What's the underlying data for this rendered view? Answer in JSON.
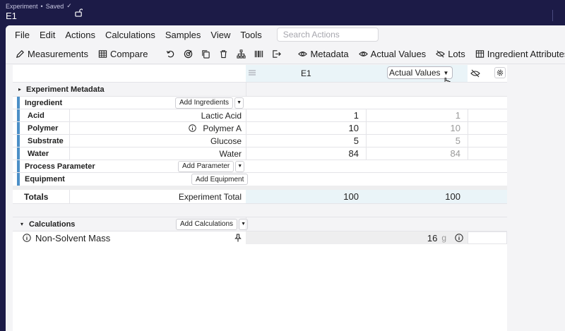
{
  "topbar": {
    "breadcrumb": "Experiment",
    "saved": "Saved",
    "check": "✓",
    "title": "E1"
  },
  "menu": {
    "items": [
      "File",
      "Edit",
      "Actions",
      "Calculations",
      "Samples",
      "View",
      "Tools"
    ],
    "search_placeholder": "Search Actions"
  },
  "toolbar": {
    "measurements": "Measurements",
    "compare": "Compare",
    "metadata": "Metadata",
    "actual_values": "Actual Values",
    "lots": "Lots",
    "ingredient_attributes": "Ingredient Attributes"
  },
  "header": {
    "column": "E1",
    "view_select": "Actual Values"
  },
  "sections": {
    "experiment_metadata": "Experiment Metadata",
    "ingredient": "Ingredient",
    "add_ingredients": "Add Ingredients",
    "process_parameter": "Process Parameter",
    "add_parameter": "Add Parameter",
    "equipment": "Equipment",
    "add_equipment": "Add Equipment"
  },
  "ingredients": [
    {
      "category": "Acid",
      "name": "Lactic Acid",
      "value": "1",
      "actual": "1"
    },
    {
      "category": "Polymer",
      "name": "Polymer A",
      "value": "10",
      "actual": "10"
    },
    {
      "category": "Substrate",
      "name": "Glucose",
      "value": "5",
      "actual": "5"
    },
    {
      "category": "Water",
      "name": "Water",
      "value": "84",
      "actual": "84"
    }
  ],
  "totals": {
    "label": "Totals",
    "sub_label": "Experiment Total",
    "value": "100",
    "actual": "100"
  },
  "calculations": {
    "label": "Calculations",
    "add_button": "Add Calculations",
    "rows": [
      {
        "name": "Non-Solvent Mass",
        "value": "16",
        "unit": "g"
      }
    ]
  }
}
